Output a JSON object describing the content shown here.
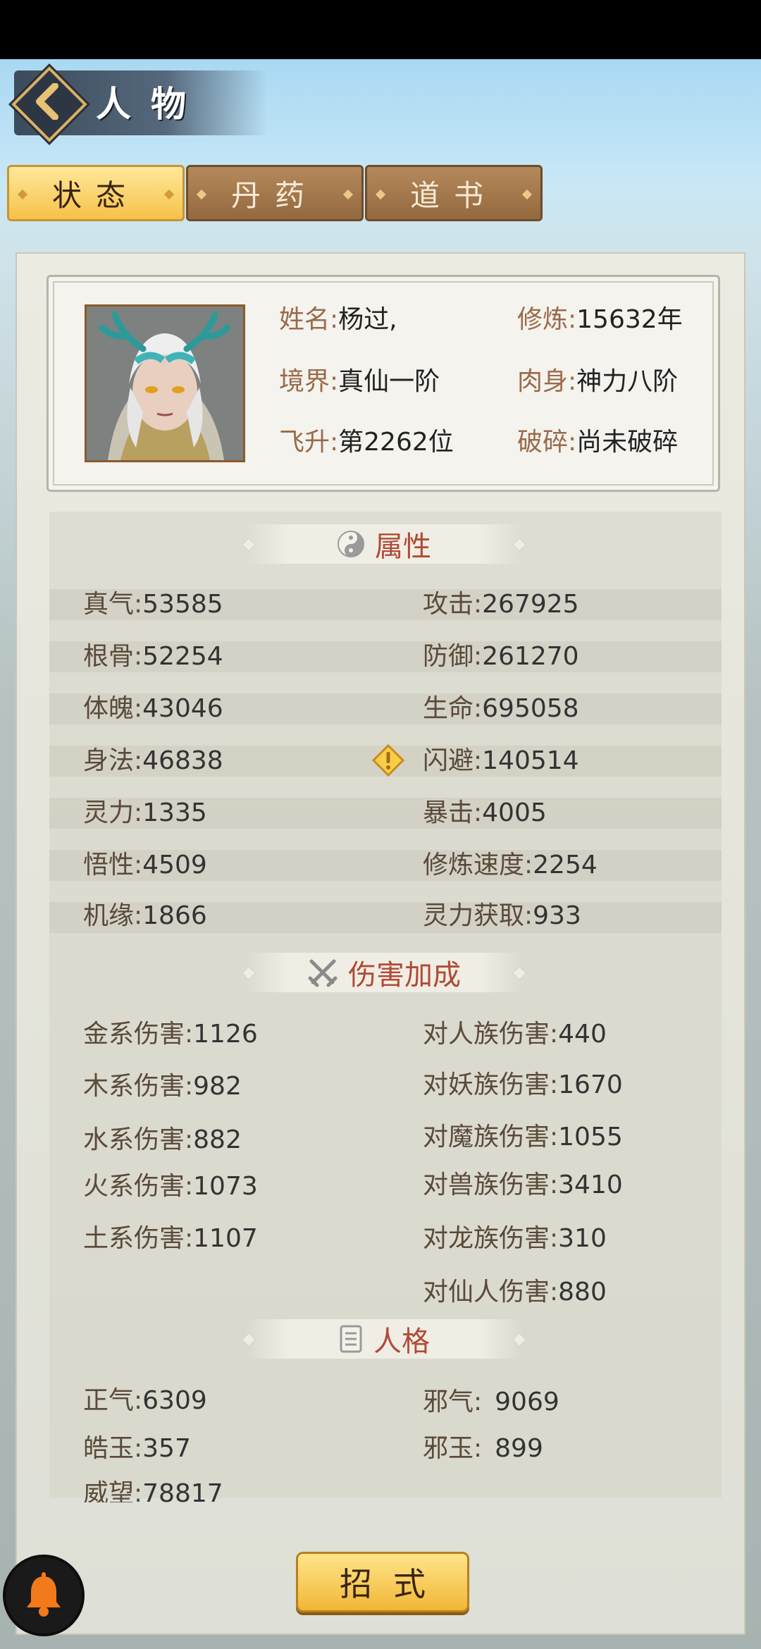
{
  "header": {
    "title": "人物"
  },
  "tabs": [
    {
      "label": "状态",
      "active": true
    },
    {
      "label": "丹药",
      "active": false
    },
    {
      "label": "道书",
      "active": false
    }
  ],
  "profile": {
    "name_label": "姓名:",
    "name": "杨过,",
    "cultivation_label": "修炼:",
    "cultivation": "15632年",
    "realm_label": "境界:",
    "realm": "真仙一阶",
    "body_label": "肉身:",
    "body": "神力八阶",
    "ascension_label": "飞升:",
    "ascension": "第2262位",
    "shatter_label": "破碎:",
    "shatter": "尚未破碎"
  },
  "attributes": {
    "title": "属性",
    "left": [
      {
        "label": "真气:",
        "value": "53585"
      },
      {
        "label": "根骨:",
        "value": "52254"
      },
      {
        "label": "体魄:",
        "value": "43046"
      },
      {
        "label": "身法:",
        "value": "46838"
      },
      {
        "label": "灵力:",
        "value": "1335"
      },
      {
        "label": "悟性:",
        "value": "4509"
      },
      {
        "label": "机缘:",
        "value": "1866"
      }
    ],
    "right": [
      {
        "label": "攻击:",
        "value": "267925"
      },
      {
        "label": "防御:",
        "value": "261270"
      },
      {
        "label": "生命:",
        "value": "695058"
      },
      {
        "label": "闪避:",
        "value": "140514"
      },
      {
        "label": "暴击:",
        "value": "4005"
      },
      {
        "label": "修炼速度:",
        "value": "2254"
      },
      {
        "label": "灵力获取:",
        "value": "933"
      }
    ]
  },
  "damage": {
    "title": "伤害加成",
    "left": [
      {
        "label": "金系伤害:",
        "value": "1126"
      },
      {
        "label": "木系伤害:",
        "value": "982"
      },
      {
        "label": "水系伤害:",
        "value": "882"
      },
      {
        "label": "火系伤害:",
        "value": "1073"
      },
      {
        "label": "土系伤害:",
        "value": "1107"
      }
    ],
    "right": [
      {
        "label": "对人族伤害:",
        "value": "440"
      },
      {
        "label": "对妖族伤害:",
        "value": "1670"
      },
      {
        "label": "对魔族伤害:",
        "value": "1055"
      },
      {
        "label": "对兽族伤害:",
        "value": "3410"
      },
      {
        "label": "对龙族伤害:",
        "value": "310"
      },
      {
        "label": "对仙人伤害:",
        "value": "880"
      }
    ]
  },
  "personality": {
    "title": "人格",
    "left": [
      {
        "label": "正气:",
        "value": "6309"
      },
      {
        "label": "皓玉:",
        "value": "357"
      },
      {
        "label": "威望:",
        "value": "78817"
      }
    ],
    "right": [
      {
        "label": "邪气:",
        "value": "9069"
      },
      {
        "label": "邪玉:",
        "value": "899"
      }
    ]
  },
  "footer": {
    "moves_button": "招式"
  },
  "icons": {
    "back": "chevron-left-icon",
    "avatar": "dragon-horned-avatar",
    "attributes": "yin-yang-icon",
    "damage": "crossed-swords-icon",
    "personality": "scroll-icon",
    "warning": "warning-diamond-icon",
    "bell": "bell-icon"
  },
  "colors": {
    "accent_red": "#b04a36",
    "gold": "#f5c248",
    "bell_orange": "#f27a1a"
  }
}
